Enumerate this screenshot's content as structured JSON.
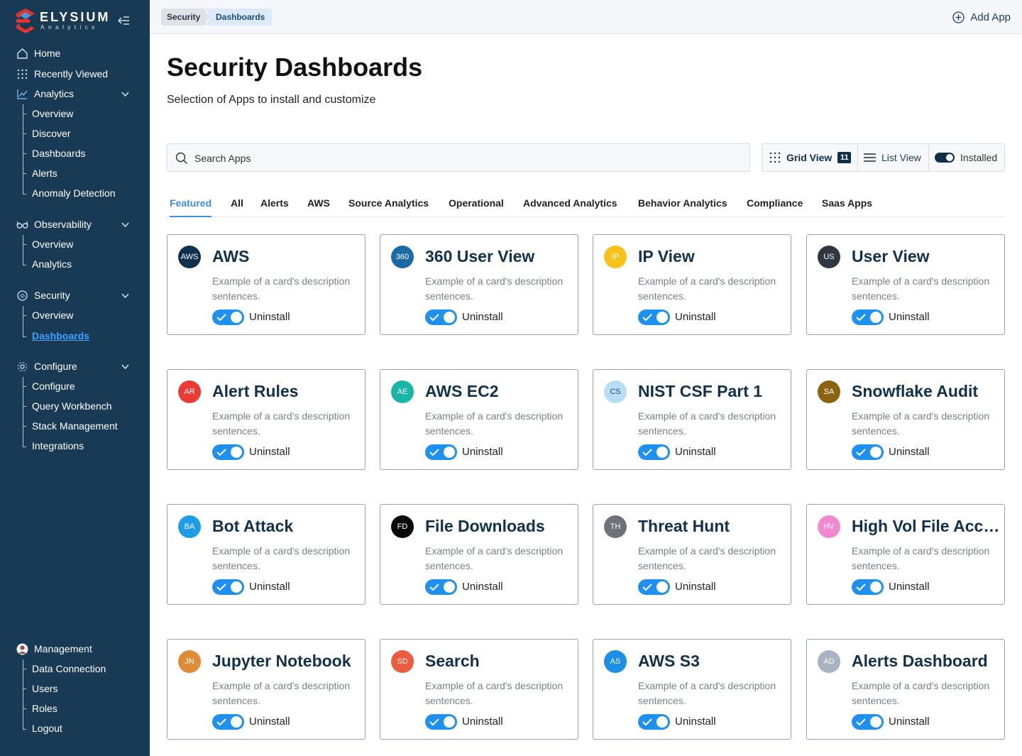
{
  "brand": {
    "name": "ELYSIUM",
    "sub": "Analytics"
  },
  "sidebar": {
    "home": "Home",
    "recently_viewed": "Recently Viewed",
    "analytics": {
      "label": "Analytics",
      "items": [
        "Overview",
        "Discover",
        "Dashboards",
        "Alerts",
        "Anomaly Detection"
      ]
    },
    "observability": {
      "label": "Observability",
      "items": [
        "Overview",
        "Analytics"
      ]
    },
    "security": {
      "label": "Security",
      "items": [
        "Overview",
        "Dashboards"
      ]
    },
    "configure": {
      "label": "Configure",
      "items": [
        "Configure",
        "Query Workbench",
        "Stack Management",
        "Integrations"
      ]
    },
    "management": {
      "label": "Management",
      "items": [
        "Data Connection",
        "Users",
        "Roles",
        "Logout"
      ]
    }
  },
  "header": {
    "breadcrumb": [
      "Security",
      "Dashboards"
    ],
    "add_app": "Add App"
  },
  "main": {
    "title": "Security Dashboards",
    "subtitle": "Selection of Apps to install and customize",
    "search_placeholder": "Search Apps",
    "views": {
      "grid": "Grid View",
      "grid_count": "11",
      "list": "List View",
      "installed": "Installed"
    },
    "tabs": [
      "Featured",
      "All",
      "Alerts",
      "AWS",
      "Source Analytics",
      "Operational",
      "Advanced Analytics",
      "Behavior Analytics",
      "Compliance",
      "Saas Apps"
    ],
    "active_tab": "Featured",
    "toggle_label": "Uninstall",
    "cards": [
      {
        "initials": "AWS",
        "title": "AWS",
        "color": "#10314d",
        "desc": "Example of a card's description sentences."
      },
      {
        "initials": "360",
        "title": "360 User View",
        "color": "#1b6aa5",
        "desc": "Example of a card's description sentences."
      },
      {
        "initials": "IP",
        "title": "IP View",
        "color": "#f6c21b",
        "desc": "Example of a card's description sentences."
      },
      {
        "initials": "US",
        "title": "User View",
        "color": "#2f3742",
        "desc": "Example of a card's description sentences."
      },
      {
        "initials": "AR",
        "title": "Alert Rules",
        "color": "#ec3a35",
        "desc": "Example of a card's description sentences."
      },
      {
        "initials": "AE",
        "title": "AWS EC2",
        "color": "#19b5a8",
        "desc": "Example of a card's description sentences."
      },
      {
        "initials": "CS",
        "title": "NIST CSF Part 1",
        "color": "#b8def6",
        "desc": "Example of a card's description sentences."
      },
      {
        "initials": "SA",
        "title": "Snowflake Audit",
        "color": "#8a6410",
        "desc": "Example of a card's description sentences."
      },
      {
        "initials": "BA",
        "title": "Bot Attack",
        "color": "#1f9ce8",
        "desc": "Example of a card's description sentences."
      },
      {
        "initials": "FD",
        "title": "File Downloads",
        "color": "#0a0a0a",
        "desc": "Example of a card's description sentences."
      },
      {
        "initials": "TH",
        "title": "Threat Hunt",
        "color": "#6e7278",
        "desc": "Example of a card's description sentences."
      },
      {
        "initials": "HV",
        "title": "High Vol File Access",
        "color": "#f08ad0",
        "desc": "Example of a card's description sentences."
      },
      {
        "initials": "JN",
        "title": "Jupyter Notebook",
        "color": "#e08b36",
        "desc": "Example of a card's description sentences."
      },
      {
        "initials": "SD",
        "title": "Search",
        "color": "#e95c3e",
        "desc": "Example of a card's description sentences."
      },
      {
        "initials": "AS",
        "title": "AWS S3",
        "color": "#1b8fe6",
        "desc": "Example of a card's description sentences."
      },
      {
        "initials": "AD",
        "title": "Alerts Dashboard",
        "color": "#a8b2c2",
        "desc": "Example of a card's description sentences."
      }
    ]
  },
  "colors": {
    "sidebar": "#193a55",
    "accent": "#1e90f0",
    "active_link": "#3ea2ff",
    "title": "#11314d"
  }
}
